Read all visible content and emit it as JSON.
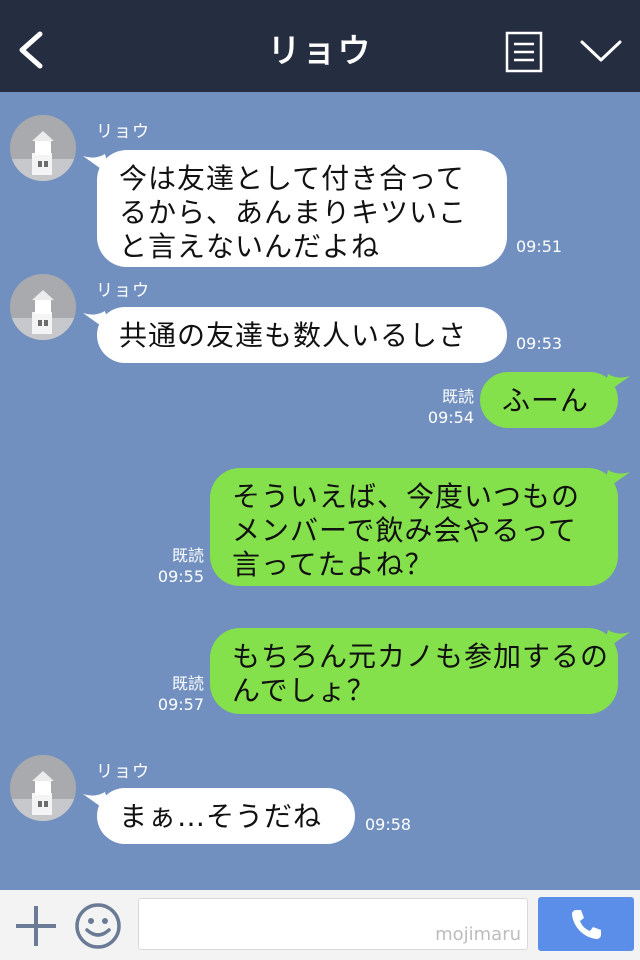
{
  "header": {
    "title": "リョウ"
  },
  "messages": [
    {
      "side": "in",
      "sender": "リョウ",
      "lines": [
        "今は友達として付き合って",
        "るから、あんまりキツいこ",
        "と言えないんだよね"
      ],
      "time": "09:51"
    },
    {
      "side": "in",
      "sender": "リョウ",
      "lines": [
        "共通の友達も数人いるしさ"
      ],
      "time": "09:53"
    },
    {
      "side": "out",
      "read": "既読",
      "lines": [
        "ふーん"
      ],
      "time": "09:54"
    },
    {
      "side": "out",
      "read": "既読",
      "lines": [
        "そういえば、今度いつもの",
        "メンバーで飲み会やるって",
        "言ってたよね？"
      ],
      "time": "09:55"
    },
    {
      "side": "out",
      "read": "既読",
      "lines": [
        "もちろん元カノも参加するの",
        "んでしょ？"
      ],
      "time": "09:57"
    },
    {
      "side": "in",
      "sender": "リョウ",
      "lines": [
        "まぁ…そうだね"
      ],
      "time": "09:58"
    }
  ],
  "footer": {
    "input_value": "",
    "watermark": "mojimaru"
  },
  "colors": {
    "header_bg": "#252d40",
    "chat_bg": "#7190bf",
    "incoming_bubble": "#ffffff",
    "outgoing_bubble": "#84e04b",
    "call_button": "#5b8ee9"
  },
  "icons": {
    "back": "chevron-left-icon",
    "menu": "menu-list-icon",
    "collapse": "chevron-down-icon",
    "add": "plus-icon",
    "sticker": "smiley-icon",
    "call": "phone-icon"
  }
}
